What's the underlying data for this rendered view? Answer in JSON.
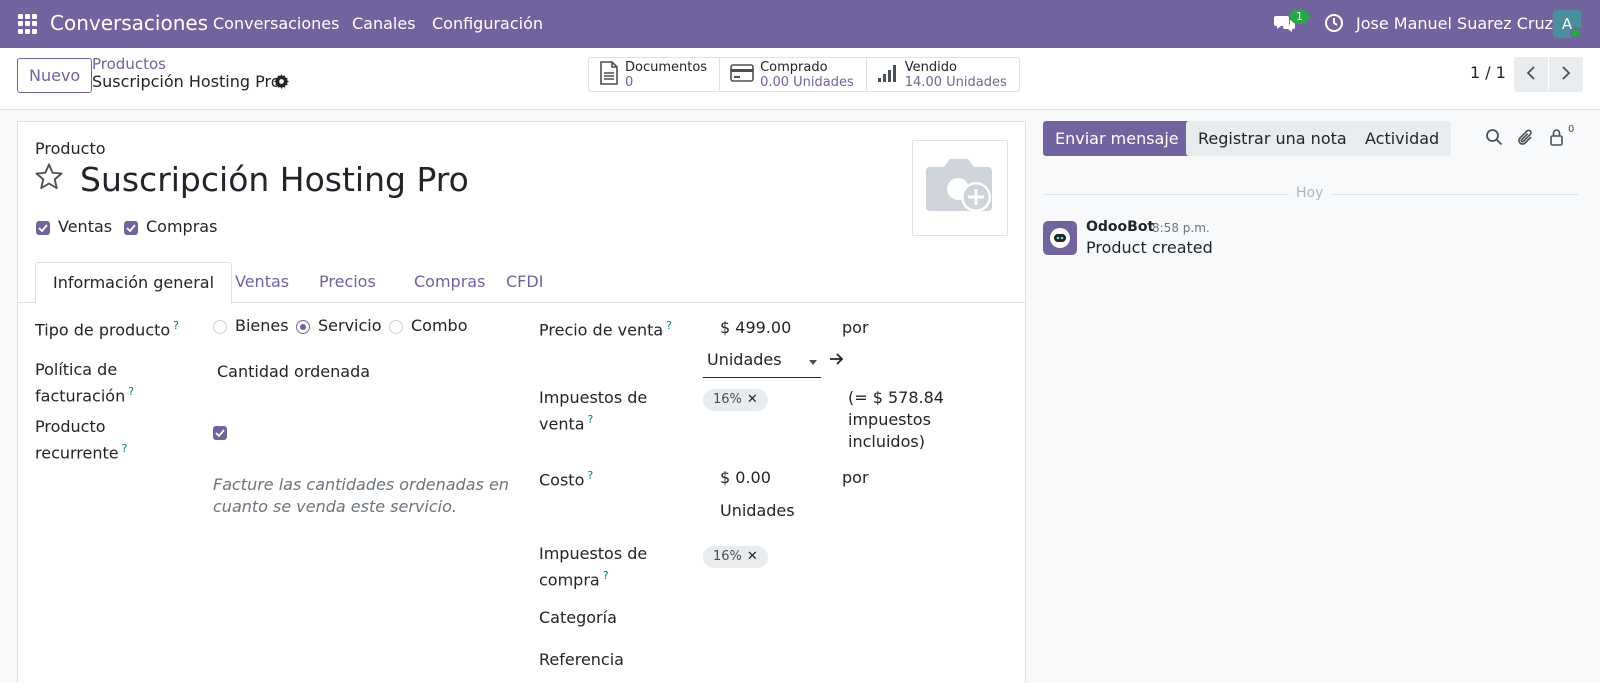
{
  "navbar": {
    "brand": "Conversaciones",
    "menu": [
      "Conversaciones",
      "Canales",
      "Configuración"
    ],
    "chat_badge": "1",
    "user_name": "Jose Manuel Suarez Cruz",
    "avatar_letter": "A"
  },
  "control_panel": {
    "new_button": "Nuevo",
    "breadcrumb_parent": "Productos",
    "breadcrumb_current": "Suscripción Hosting Pro",
    "stats": [
      {
        "label": "Documentos",
        "value": "0",
        "icon": "document-icon"
      },
      {
        "label": "Comprado",
        "value": "0.00 Unidades",
        "icon": "credit-card-icon"
      },
      {
        "label": "Vendido",
        "value": "14.00 Unidades",
        "icon": "signal-icon"
      }
    ],
    "pager": "1 / 1"
  },
  "form": {
    "product_label": "Producto",
    "product_name": "Suscripción Hosting Pro",
    "can_be_sold_label": "Ventas",
    "can_be_purchased_label": "Compras",
    "tabs": [
      "Información general",
      "Ventas",
      "Precios",
      "Compras",
      "CFDI"
    ],
    "product_type": {
      "label": "Tipo de producto",
      "options": [
        "Bienes",
        "Servicio",
        "Combo"
      ],
      "selected": "Servicio"
    },
    "invoice_policy": {
      "label_line1": "Política de",
      "label_line2": "facturación",
      "value": "Cantidad ordenada"
    },
    "recurring": {
      "label_line1": "Producto",
      "label_line2": "recurrente",
      "checked": true
    },
    "help_text": "Facture las cantidades ordenadas en cuanto se venda este servicio.",
    "sale_price": {
      "label": "Precio de venta",
      "value": "$ 499.00",
      "per": "por",
      "uom": "Unidades"
    },
    "sale_taxes": {
      "label_line1": "Impuestos de",
      "label_line2": "venta",
      "tag": "16%",
      "tax_included_line1": "(= $ 578.84",
      "tax_included_line2": "impuestos",
      "tax_included_line3": "incluidos)"
    },
    "cost": {
      "label": "Costo",
      "value": "$ 0.00",
      "per": "por",
      "uom": "Unidades"
    },
    "purchase_taxes": {
      "label_line1": "Impuestos de",
      "label_line2": "compra",
      "tag": "16%"
    },
    "category_label": "Categoría",
    "reference_label": "Referencia"
  },
  "chatter": {
    "send_message": "Enviar mensaje",
    "log_note": "Registrar una nota",
    "activity": "Actividad",
    "follower_count": "0",
    "date_separator": "Hoy",
    "messages": [
      {
        "author": "OdooBot",
        "time": "8:58 p.m.",
        "body": "Product created"
      }
    ]
  },
  "colors": {
    "brand": "#71639e",
    "badge": "#28a745",
    "link": "#71639e"
  }
}
